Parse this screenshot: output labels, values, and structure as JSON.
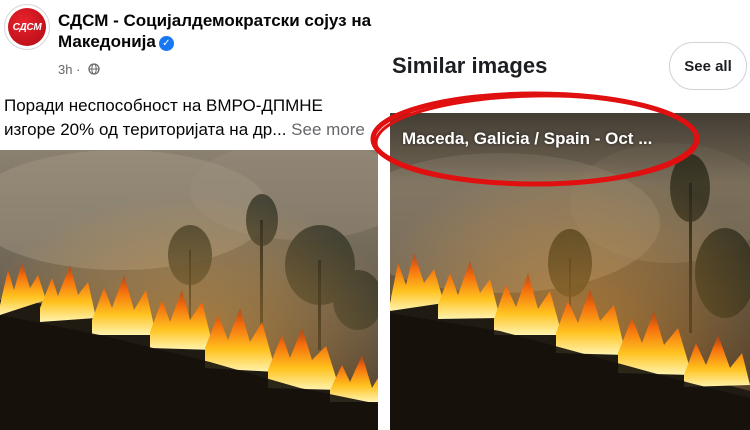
{
  "post": {
    "avatar_text": "СДСМ",
    "page_name": "СДСМ - Социјалдемократски сојуз на Македонија",
    "verified_icon": "✓",
    "timestamp": "3h ·",
    "text": "Поради неспособност на ВМРО-ДПМНЕ изгоре 20% од територијата на др...",
    "see_more": "See more",
    "icons": [
      "verified-badge-icon",
      "globe-icon"
    ]
  },
  "similar_images": {
    "title": "Similar images",
    "see_all": "See all",
    "result_caption": "Maceda, Galicia / Spain - Oct ..."
  },
  "colors": {
    "facebook_blue": "#1877f2",
    "avatar_red": "#c2121b",
    "annotation_red": "#e01010",
    "meta_gray": "#65676b"
  }
}
